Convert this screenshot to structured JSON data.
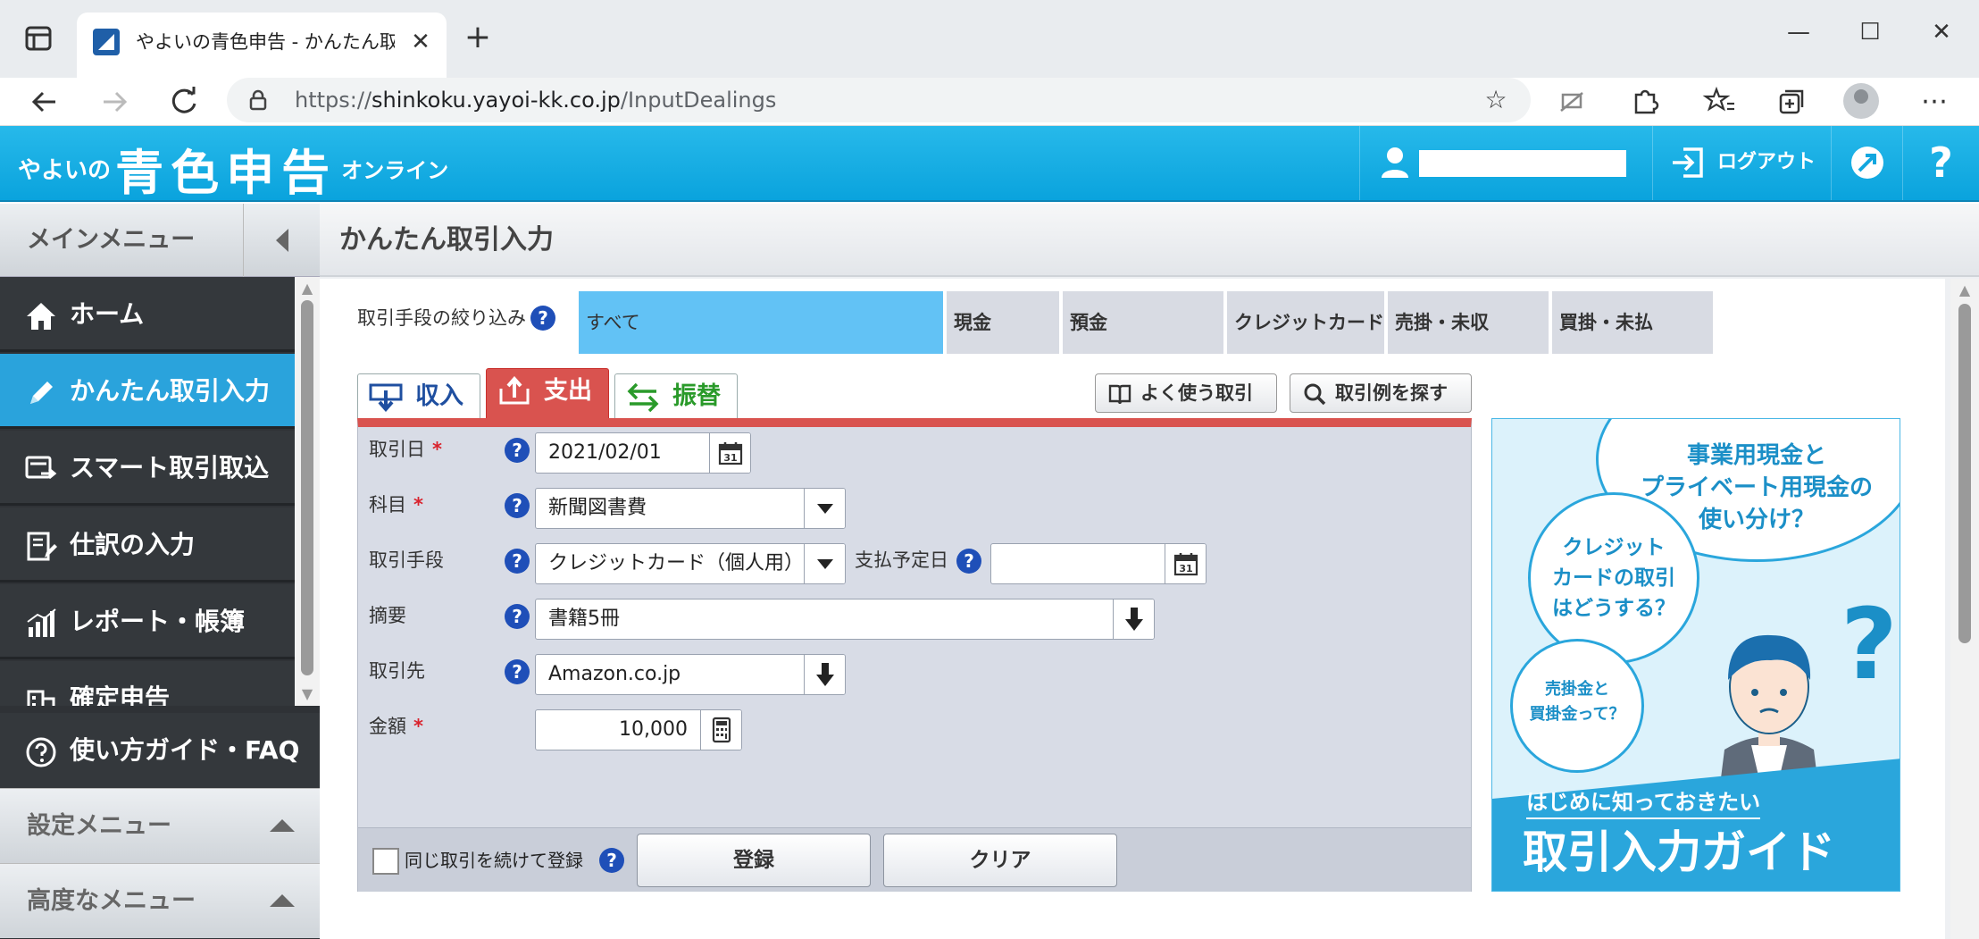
{
  "browser": {
    "tab_title": "やよいの青色申告 - かんたん取引入",
    "url_prefix": "https://",
    "url_host": "shinkoku.yayoi-kk.co.jp",
    "url_path": "/InputDealings"
  },
  "header": {
    "logo_small": "やよいの",
    "logo_big": "青色申告",
    "logo_online": "オンライン",
    "logout_label": "ログアウト",
    "help_label": "?"
  },
  "sidebar": {
    "main_menu_label": "メインメニュー",
    "items": [
      {
        "label": "ホーム",
        "icon": "home-icon"
      },
      {
        "label": "かんたん取引入力",
        "icon": "pencil-icon"
      },
      {
        "label": "スマート取引取込",
        "icon": "import-icon"
      },
      {
        "label": "仕訳の入力",
        "icon": "journal-icon"
      },
      {
        "label": "レポート・帳簿",
        "icon": "report-icon"
      },
      {
        "label": "確定申告",
        "icon": "building-icon"
      }
    ],
    "guide_label": "使い方ガイド・FAQ",
    "settings_label": "設定メニュー",
    "advanced_label": "高度なメニュー"
  },
  "page": {
    "title": "かんたん取引入力",
    "filter_label": "取引手段の絞り込み",
    "filter_tabs": [
      "すべて",
      "現金",
      "預金",
      "クレジットカード",
      "売掛・未収",
      "買掛・未払"
    ],
    "kind_tabs": [
      "収入",
      "支出",
      "振替"
    ],
    "actions": [
      "よく使う取引",
      "取引例を探す"
    ]
  },
  "form": {
    "date_label": "取引日",
    "date_value": "2021/02/01",
    "account_label": "科目",
    "account_value": "新聞図書費",
    "method_label": "取引手段",
    "method_value": "クレジットカード（個人用）",
    "due_label": "支払予定日",
    "due_value": "",
    "memo_label": "摘要",
    "memo_value": "書籍5冊",
    "partner_label": "取引先",
    "partner_value": "Amazon.co.jp",
    "amount_label": "金額",
    "amount_value": "10,000",
    "required_mark": "*",
    "continue_label": "同じ取引を続けて登録",
    "register_button": "登録",
    "clear_button": "クリア"
  },
  "banner": {
    "bubble_1": "事業用現金と\nプライベート用現金の\n使い分け？",
    "bubble_2": "クレジット\nカードの取引\nはどうする？",
    "bubble_3": "売掛金と\n買掛金って？",
    "subtitle": "はじめに知っておきたい",
    "title": "取引入力ガイド"
  },
  "colors": {
    "header_blue": "#0aa3dd",
    "active_nav": "#2aa3dc",
    "expense_red": "#d9534f",
    "filter_active": "#62c2f5"
  }
}
